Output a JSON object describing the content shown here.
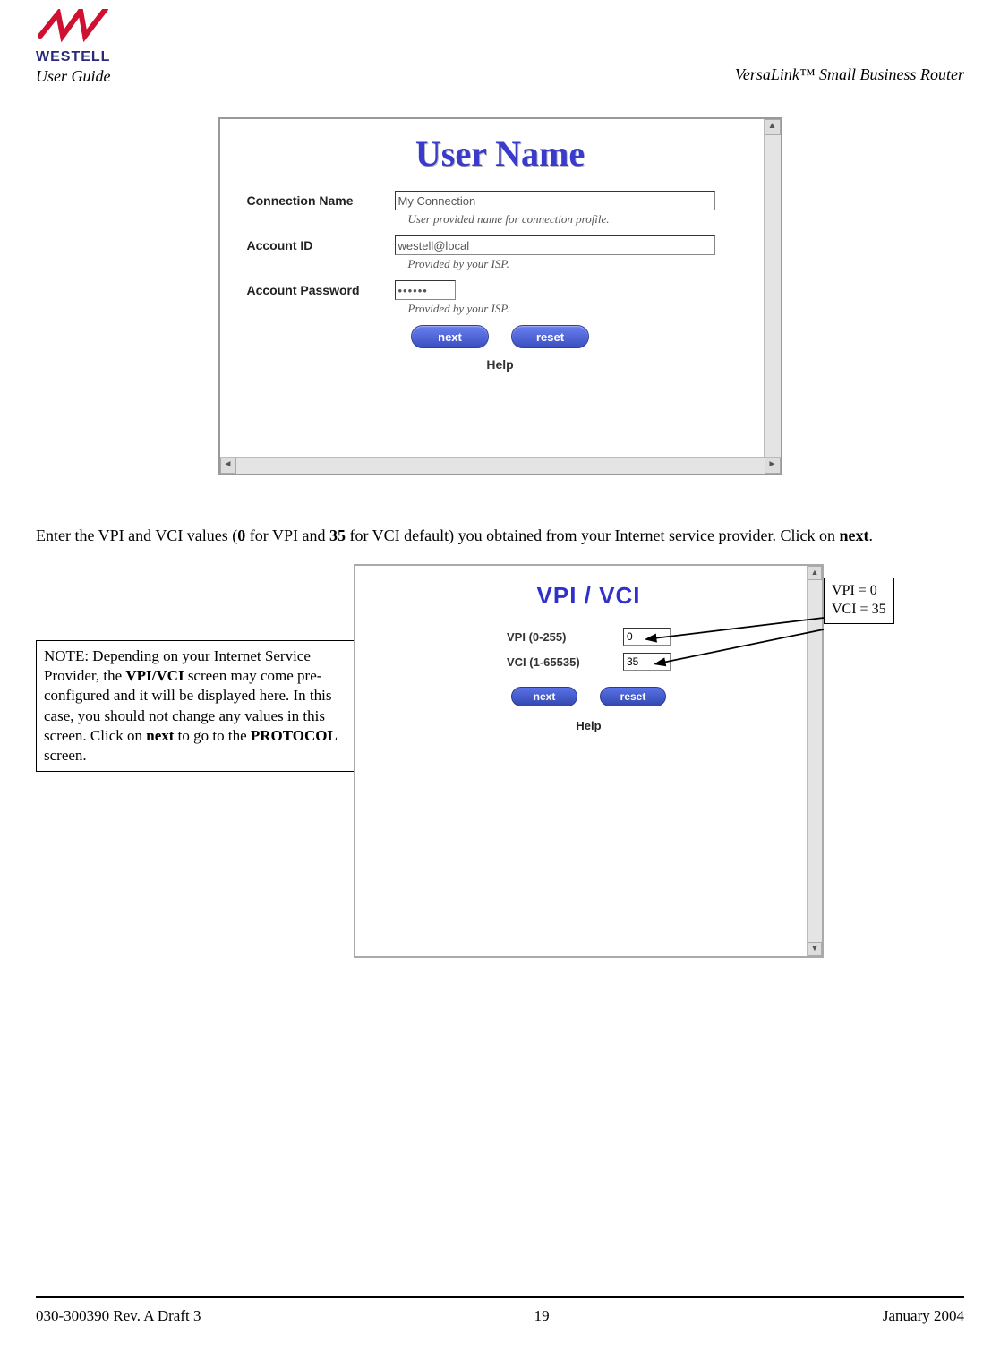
{
  "header": {
    "brand": "WESTELL",
    "guide_label": "User Guide",
    "product": "VersaLink™  Small Business Router"
  },
  "panel1": {
    "title": "User Name",
    "rows": {
      "conn_name_label": "Connection Name",
      "conn_name_value": "My Connection",
      "conn_name_hint": "User provided name for connection profile.",
      "account_id_label": "Account ID",
      "account_id_value": "westell@local",
      "account_id_hint": "Provided by your ISP.",
      "account_pw_label": "Account Password",
      "account_pw_value": "••••••",
      "account_pw_hint": "Provided by your ISP."
    },
    "buttons": {
      "next": "next",
      "reset": "reset"
    },
    "help": "Help"
  },
  "paragraph": {
    "pre": "Enter the VPI and VCI values (",
    "b1": "0",
    "mid1": " for VPI and ",
    "b2": "35",
    "mid2": " for VCI default) you obtained from your Internet service provider. Click on ",
    "b3": "next",
    "post": "."
  },
  "note": {
    "pre": "NOTE: Depending on your Internet Service Provider, the ",
    "b1": "VPI/VCI",
    "mid1": " screen may come pre-configured and it will be displayed here. In this case, you should not change any values in this screen. Click on ",
    "b2": "next",
    "mid2": " to go to the ",
    "b3": "PROTOCOL",
    "post": " screen."
  },
  "panel2": {
    "title": "VPI / VCI",
    "vpi_label": "VPI (0-255)",
    "vpi_value": "0",
    "vci_label": "VCI (1-65535)",
    "vci_value": "35",
    "buttons": {
      "next": "next",
      "reset": "reset"
    },
    "help": "Help"
  },
  "callout": {
    "line1": "VPI = 0",
    "line2": "VCI = 35"
  },
  "footer": {
    "left": "030-300390 Rev. A Draft 3",
    "center": "19",
    "right": "January 2004"
  }
}
